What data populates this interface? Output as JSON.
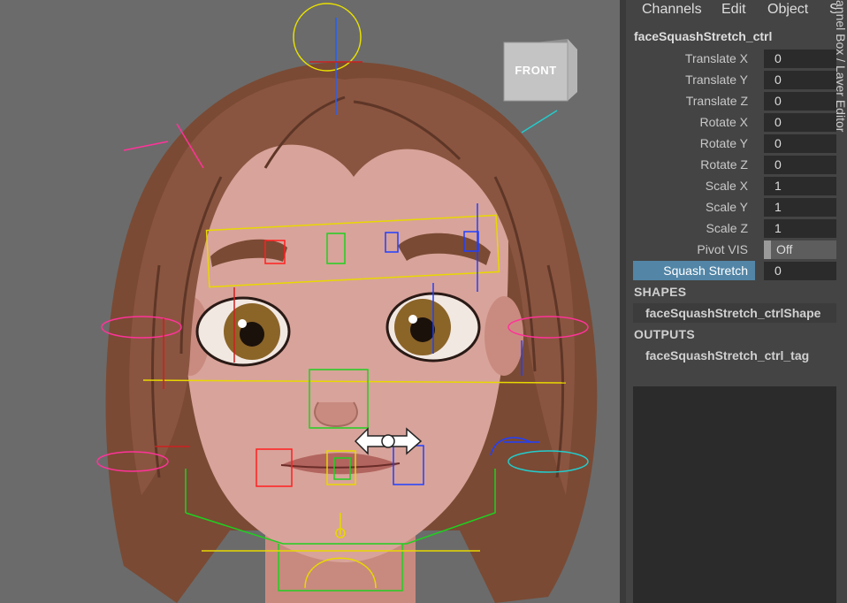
{
  "viewport": {
    "view_cube": {
      "label": "FRONT"
    }
  },
  "channel_box": {
    "menus": [
      "Channels",
      "Edit",
      "Object",
      "S"
    ],
    "node_name": "faceSquashStretch_ctrl",
    "attributes": [
      {
        "label": "Translate X",
        "value": "0"
      },
      {
        "label": "Translate Y",
        "value": "0"
      },
      {
        "label": "Translate Z",
        "value": "0"
      },
      {
        "label": "Rotate X",
        "value": "0"
      },
      {
        "label": "Rotate Y",
        "value": "0"
      },
      {
        "label": "Rotate Z",
        "value": "0"
      },
      {
        "label": "Scale X",
        "value": "1"
      },
      {
        "label": "Scale Y",
        "value": "1"
      },
      {
        "label": "Scale Z",
        "value": "1"
      },
      {
        "label": "Pivot VIS",
        "value": "Off"
      },
      {
        "label": "Squash Stretch",
        "value": "0"
      }
    ],
    "selected_attribute": "Squash Stretch",
    "shapes": {
      "header": "SHAPES",
      "node": "faceSquashStretch_ctrlShape"
    },
    "outputs": {
      "header": "OUTPUTS",
      "node": "faceSquashStretch_ctrl_tag"
    }
  },
  "right_strip": {
    "label": "annel Box / Layer Editor"
  },
  "colors": {
    "selected_row": "#5285a6",
    "panel_bg": "#444444",
    "field_bg": "#2b2b2b",
    "viewport_bg": "#6b6b6b"
  },
  "icons": [
    "view-cube-icon",
    "move-cursor-icon"
  ]
}
